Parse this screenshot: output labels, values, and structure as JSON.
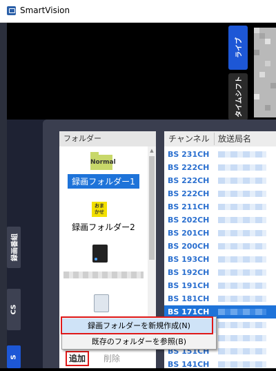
{
  "window": {
    "title": "SmartVision",
    "icon": "app-icon"
  },
  "right_tabs": [
    {
      "label": "ライブ",
      "color": "#1d57d6"
    },
    {
      "label": "タイムシフト",
      "color": "#2a2a2a"
    }
  ],
  "left_tabs": [
    {
      "label": "録画番組",
      "color": "#3d4152"
    },
    {
      "label": "CS",
      "color": "#3d4152"
    },
    {
      "label": "S",
      "color": "#1d57d6"
    }
  ],
  "folder_panel": {
    "header": "フォルダー",
    "items": [
      {
        "icon": "normal-folder-icon",
        "icon_text": "Normal",
        "label": "録画フォルダー1",
        "selected": true
      },
      {
        "icon": "omakase-folder-icon",
        "icon_text": "おま\nかせ",
        "label": "録画フォルダー2",
        "selected": false
      },
      {
        "icon": "hdd-icon",
        "label": "",
        "selected": false
      },
      {
        "icon": "usb-drive-icon",
        "label": "",
        "selected": false
      }
    ],
    "add_label": "追加",
    "delete_label": "削除"
  },
  "channel_panel": {
    "col_channel": "チャンネル",
    "col_station": "放送局名",
    "rows": [
      {
        "channel": "BS 231CH",
        "selected": false
      },
      {
        "channel": "BS 222CH",
        "selected": false
      },
      {
        "channel": "BS 222CH",
        "selected": false
      },
      {
        "channel": "BS 222CH",
        "selected": false
      },
      {
        "channel": "BS 211CH",
        "selected": false
      },
      {
        "channel": "BS 202CH",
        "selected": false
      },
      {
        "channel": "BS 201CH",
        "selected": false
      },
      {
        "channel": "BS 200CH",
        "selected": false
      },
      {
        "channel": "BS 193CH",
        "selected": false
      },
      {
        "channel": "BS 192CH",
        "selected": false
      },
      {
        "channel": "BS 191CH",
        "selected": false
      },
      {
        "channel": "BS 181CH",
        "selected": false
      },
      {
        "channel": "BS 171CH",
        "selected": true
      },
      {
        "channel": "BS 171CH",
        "selected": false
      },
      {
        "channel": "BS 161CH",
        "selected": false
      },
      {
        "channel": "BS 151CH",
        "selected": false
      },
      {
        "channel": "BS 141CH",
        "selected": false
      }
    ]
  },
  "context_menu": {
    "items": [
      {
        "label": "録画フォルダーを新規作成(N)",
        "highlighted": true
      },
      {
        "label": "既存のフォルダーを参照(B)",
        "highlighted": false
      }
    ]
  },
  "colors": {
    "accent": "#1e73d9",
    "highlight_border": "#e01818",
    "channel_text": "#2a6fcf"
  }
}
